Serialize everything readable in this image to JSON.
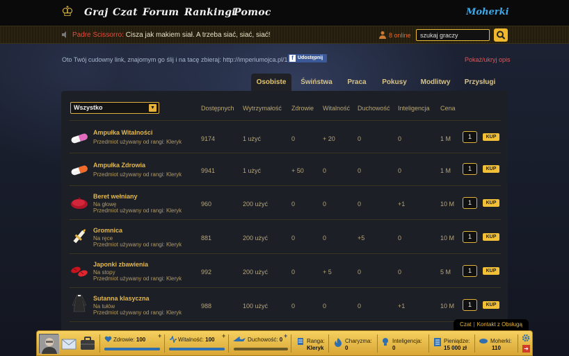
{
  "nav": {
    "items": [
      "Graj",
      "Czat",
      "Forum",
      "Rankingi",
      "Pomoc"
    ],
    "moherki": "Moherki"
  },
  "chat": {
    "author": "Padre Scissorro:",
    "message": " Cisza jak makiem siał. A trzeba siać, siać, siać!",
    "online": "8 online"
  },
  "search": {
    "value": "szukaj graczy"
  },
  "link_row": {
    "text": "Oto Twój cudowny link, znajomym go ślij i na tacę zbieraj: http://imperiumojca.pl/13",
    "share": "Udostępnij",
    "toggle": "Pokaż/ukryj opis"
  },
  "tabs": [
    "Osobiste",
    "Świństwa",
    "Praca",
    "Pokusy",
    "Modlitwy",
    "Przysługi"
  ],
  "filter": {
    "selected": "Wszystko"
  },
  "columns": [
    "Dostępnych",
    "Wytrzymałość",
    "Zdrowie",
    "Witalność",
    "Duchowość",
    "Inteligencja",
    "Cena"
  ],
  "items": [
    {
      "name": "Ampułka Witalności",
      "slot": "",
      "rank": "Przedmiot używany od rangi: Kleryk",
      "available": "9174",
      "durability": "1 użyć",
      "health": "0",
      "vitality": "+ 20",
      "spirit": "0",
      "intel": "0",
      "price": "1 M",
      "qty": "1",
      "icon": "pill-pink-icon"
    },
    {
      "name": "Ampułka Zdrowia",
      "slot": "",
      "rank": "Przedmiot używany od rangi: Kleryk",
      "available": "9941",
      "durability": "1 użyć",
      "health": "+ 50",
      "vitality": "0",
      "spirit": "0",
      "intel": "0",
      "price": "1 M",
      "qty": "1",
      "icon": "pill-orange-icon"
    },
    {
      "name": "Beret wełniany",
      "slot": "Na głowę",
      "rank": "Przedmiot używany od rangi: Kleryk",
      "available": "960",
      "durability": "200 użyć",
      "health": "0",
      "vitality": "0",
      "spirit": "0",
      "intel": "+1",
      "price": "10 M",
      "qty": "1",
      "icon": "beret-icon"
    },
    {
      "name": "Gromnica",
      "slot": "Na ręce",
      "rank": "Przedmiot używany od rangi: Kleryk",
      "available": "881",
      "durability": "200 użyć",
      "health": "0",
      "vitality": "0",
      "spirit": "+5",
      "intel": "0",
      "price": "10 M",
      "qty": "1",
      "icon": "candle-icon"
    },
    {
      "name": "Japonki zbawienia",
      "slot": "Na stopy",
      "rank": "Przedmiot używany od rangi: Kleryk",
      "available": "992",
      "durability": "200 użyć",
      "health": "0",
      "vitality": "+ 5",
      "spirit": "0",
      "intel": "0",
      "price": "5 M",
      "qty": "1",
      "icon": "sandals-icon"
    },
    {
      "name": "Sutanna klasyczna",
      "slot": "Na tułów",
      "rank": "Przedmiot używany od rangi: Kleryk",
      "available": "988",
      "durability": "100 użyć",
      "health": "0",
      "vitality": "0",
      "spirit": "0",
      "intel": "+1",
      "price": "10 M",
      "qty": "1",
      "icon": "cassock-icon"
    }
  ],
  "buy_label": "KUP",
  "chat_links": {
    "chat": "Czat",
    "contact": "Kontakt z Obsługą"
  },
  "status": {
    "health_label": "Zdrowie: ",
    "health": "100",
    "health_fill": 1.0,
    "vitality_label": "Witalność: ",
    "vitality": "100",
    "vitality_fill": 1.0,
    "spirit_label": "Duchowość: ",
    "spirit": "0",
    "rank_label": "Ranga:",
    "rank": "Kleryk",
    "charisma_label": "Charyzma:",
    "charisma": "0",
    "intel_label": "Inteligencja:",
    "intel": "0",
    "money_label": "Pieniądze:",
    "money": "15 000 zł",
    "moherki_label": "Moherki:",
    "moherki": "110"
  },
  "colors": {
    "accent": "#f0b82d",
    "name": "#e4b94e",
    "chat_author": "#e74a3b",
    "link": "#3fa9e8"
  }
}
